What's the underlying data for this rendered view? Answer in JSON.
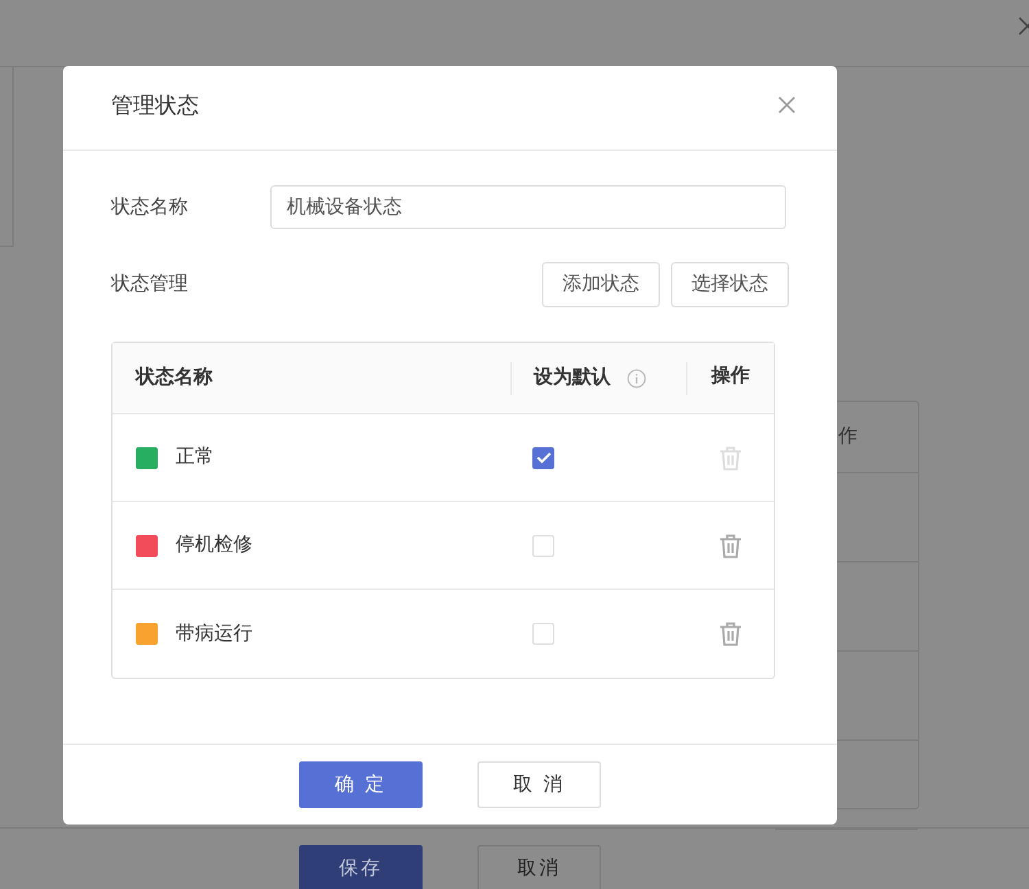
{
  "background": {
    "table_header_fragment": "作",
    "buttons": [
      {
        "label": "保存",
        "kind": "primary"
      },
      {
        "label": "取消",
        "kind": "default"
      }
    ]
  },
  "dialog": {
    "title": "管理状态",
    "fields": [
      {
        "label": "状态名称",
        "value": "机械设备状态"
      }
    ],
    "section_label": "状态管理",
    "actions": [
      "添加状态",
      "选择状态"
    ],
    "table": {
      "columns": [
        {
          "label": "状态名称",
          "info": false
        },
        {
          "label": "设为默认",
          "info": true
        },
        {
          "label": "操作",
          "info": false
        }
      ],
      "rows": [
        {
          "name": "正常",
          "color": "#27ae60",
          "checked": true,
          "delete_disabled": true
        },
        {
          "name": "停机检修",
          "color": "#f24b5a",
          "checked": false,
          "delete_disabled": false
        },
        {
          "name": "带病运行",
          "color": "#f9a22f",
          "checked": false,
          "delete_disabled": false
        }
      ]
    },
    "buttons": [
      {
        "label": "确 定",
        "kind": "primary"
      },
      {
        "label": "取 消",
        "kind": "default"
      }
    ]
  }
}
